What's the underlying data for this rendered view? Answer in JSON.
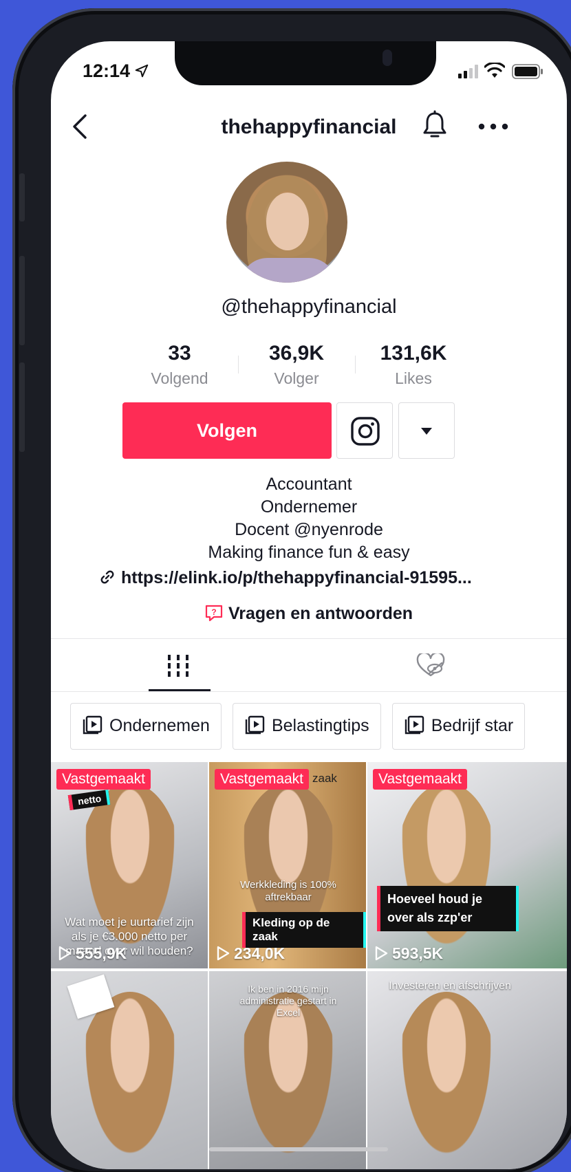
{
  "status_bar": {
    "time": "12:14"
  },
  "header": {
    "title": "thehappyfinancial"
  },
  "profile": {
    "username": "@thehappyfinancial",
    "stats": [
      {
        "value": "33",
        "label": "Volgend"
      },
      {
        "value": "36,9K",
        "label": "Volger"
      },
      {
        "value": "131,6K",
        "label": "Likes"
      }
    ],
    "follow_label": "Volgen",
    "bio": [
      "Accountant",
      "Ondernemer",
      "Docent @nyenrode",
      "Making finance fun & easy"
    ],
    "link": "https://elink.io/p/thehappyfinancial-91595...",
    "qa_label": "Vragen en antwoorden"
  },
  "playlists": [
    "Ondernemen",
    "Belastingtips",
    "Bedrijf star"
  ],
  "videos": [
    {
      "pinned": "Vastgemaakt",
      "views": "555,9K",
      "caption": "Wat moet je uurtarief zijn als je €3.000 netto per maand over wil houden?",
      "top_tag": "netto"
    },
    {
      "pinned": "Vastgemaakt",
      "views": "234,0K",
      "caption": "Werkkleding is 100% aftrekbaar",
      "box_caption": "Kleding op de zaak",
      "top_tag": "zaak"
    },
    {
      "pinned": "Vastgemaakt",
      "views": "593,5K",
      "box_caption": "Hoeveel houd je over als zzp'er"
    },
    {
      "caption": ""
    },
    {
      "caption": "Ik ben in 2016 mijn administratie gestart in Excel"
    },
    {
      "caption": "Investeren en afschrijven"
    }
  ],
  "colors": {
    "accent": "#fe2c55",
    "background": "#3f57d8"
  }
}
